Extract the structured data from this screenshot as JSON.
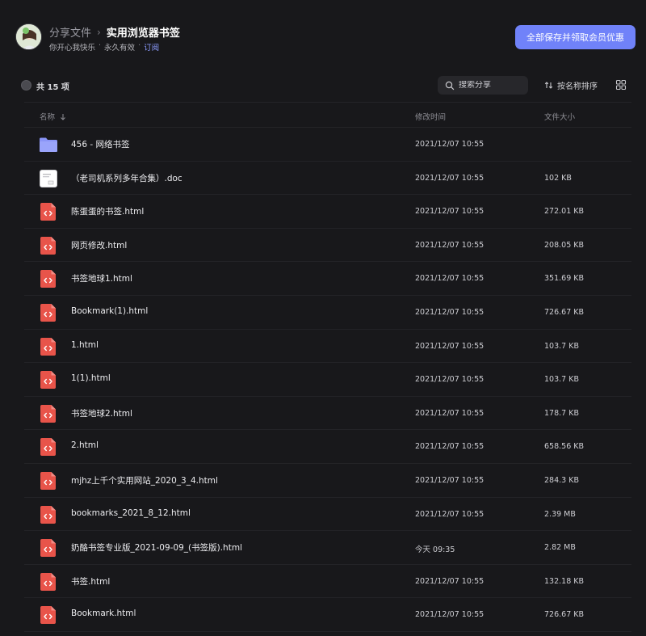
{
  "header": {
    "breadcrumb_parent": "分享文件",
    "breadcrumb_separator": "›",
    "title": "实用浏览器书签",
    "sharer": "你开心我快乐",
    "validity": "永久有效",
    "dot": "·",
    "subscribe": "订阅",
    "cta_label": "全部保存并领取会员优惠"
  },
  "toolbar": {
    "count_label": "共 15 项",
    "search_placeholder": "搜索分享",
    "sort_label": "按名称排序"
  },
  "columns": {
    "name": "名称",
    "time": "修改时间",
    "size": "文件大小"
  },
  "colors": {
    "accent": "#7082f9",
    "folder": "#8a95f7",
    "html_icon": "#e8544a",
    "background": "#18181b"
  },
  "files": [
    {
      "name": "456 - 网络书签",
      "time": "2021/12/07 10:55",
      "size": "",
      "icon": "folder-icon"
    },
    {
      "name": "（老司机系列多年合集）.doc",
      "time": "2021/12/07 10:55",
      "size": "102 KB",
      "icon": "doc-file-icon"
    },
    {
      "name": "陈蛋蛋的书签.html",
      "time": "2021/12/07 10:55",
      "size": "272.01 KB",
      "icon": "html-file-icon"
    },
    {
      "name": "网页修改.html",
      "time": "2021/12/07 10:55",
      "size": "208.05 KB",
      "icon": "html-file-icon"
    },
    {
      "name": "书签地球1.html",
      "time": "2021/12/07 10:55",
      "size": "351.69 KB",
      "icon": "html-file-icon"
    },
    {
      "name": "Bookmark(1).html",
      "time": "2021/12/07 10:55",
      "size": "726.67 KB",
      "icon": "html-file-icon"
    },
    {
      "name": "1.html",
      "time": "2021/12/07 10:55",
      "size": "103.7 KB",
      "icon": "html-file-icon"
    },
    {
      "name": "1(1).html",
      "time": "2021/12/07 10:55",
      "size": "103.7 KB",
      "icon": "html-file-icon"
    },
    {
      "name": "书签地球2.html",
      "time": "2021/12/07 10:55",
      "size": "178.7 KB",
      "icon": "html-file-icon"
    },
    {
      "name": "2.html",
      "time": "2021/12/07 10:55",
      "size": "658.56 KB",
      "icon": "html-file-icon"
    },
    {
      "name": "mjhz上千个实用网站_2020_3_4.html",
      "time": "2021/12/07 10:55",
      "size": "284.3 KB",
      "icon": "html-file-icon"
    },
    {
      "name": "bookmarks_2021_8_12.html",
      "time": "2021/12/07 10:55",
      "size": "2.39 MB",
      "icon": "html-file-icon"
    },
    {
      "name": "奶酪书签专业版_2021-09-09_(书签版).html",
      "time": "今天 09:35",
      "size": "2.82 MB",
      "icon": "html-file-icon"
    },
    {
      "name": "书签.html",
      "time": "2021/12/07 10:55",
      "size": "132.18 KB",
      "icon": "html-file-icon"
    },
    {
      "name": "Bookmark.html",
      "time": "2021/12/07 10:55",
      "size": "726.67 KB",
      "icon": "html-file-icon"
    }
  ]
}
